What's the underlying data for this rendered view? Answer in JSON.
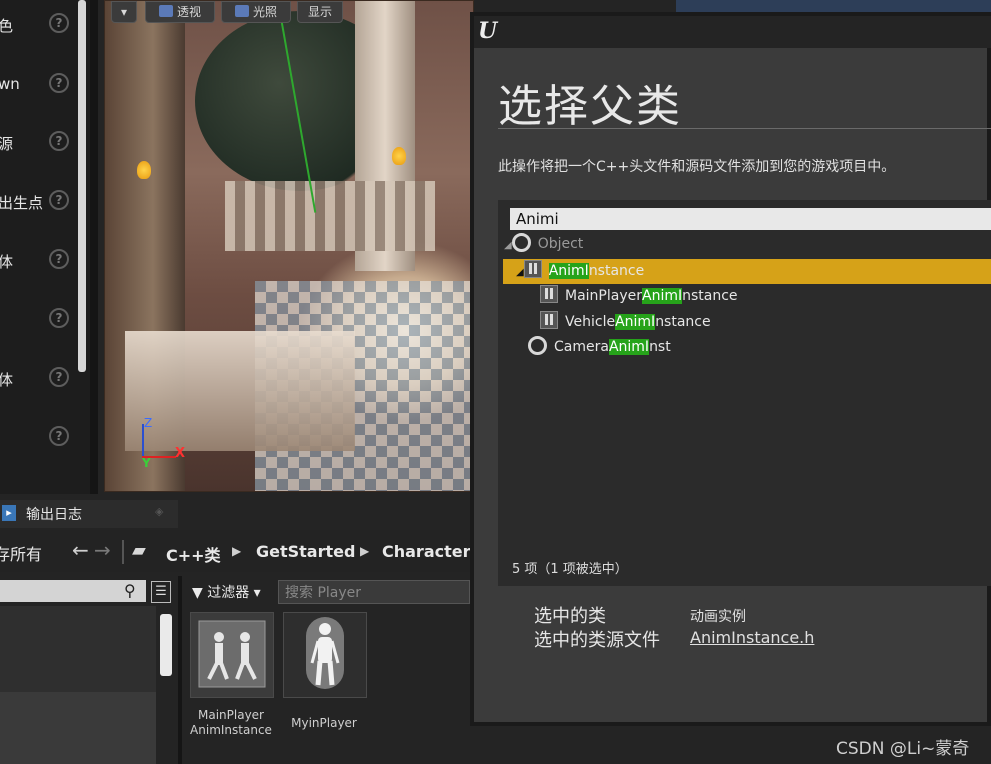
{
  "details_panel": {
    "rows": [
      {
        "label": "色",
        "help": "?"
      },
      {
        "label": "wn",
        "help": "?"
      },
      {
        "label": "源",
        "help": "?"
      },
      {
        "label": "出生点",
        "help": "?"
      },
      {
        "label": "体",
        "help": "?"
      },
      {
        "label": "",
        "help": "?"
      },
      {
        "label": "体",
        "help": "?"
      },
      {
        "label": "",
        "help": "?"
      }
    ]
  },
  "viewport": {
    "buttons": {
      "perspective": "透视",
      "lit": "光照",
      "show": "显示"
    },
    "gizmo": {
      "x": "X",
      "y": "Y",
      "z": "Z"
    }
  },
  "output_log": {
    "title": "输出日志"
  },
  "content_browser": {
    "save_all": "存所有",
    "breadcrumbs": [
      "C++类",
      "GetStarted",
      "Characters"
    ],
    "filter_label": "过滤器",
    "search_placeholder": "搜索 Player",
    "assets": [
      {
        "name_line1": "MainPlayer",
        "name_line2": "AnimInstance"
      },
      {
        "name_line1": "MyinPlayer",
        "name_line2": ""
      }
    ]
  },
  "dialog": {
    "logo": "U",
    "heading": "选择父类",
    "description": "此操作将把一个C++头文件和源码文件添加到您的游戏项目中。",
    "search_value": "Animi",
    "tree": {
      "root": "Object",
      "selected": {
        "prefix": "",
        "match": "AnimI",
        "suffix": "nstance"
      },
      "children": [
        {
          "prefix": "MainPlayer",
          "match": "AnimI",
          "suffix": "nstance"
        },
        {
          "prefix": "Vehicle",
          "match": "AnimI",
          "suffix": "nstance"
        }
      ],
      "sibling": {
        "prefix": "Camera",
        "match": "AnimI",
        "suffix": "nst"
      }
    },
    "item_count": "5 项（1 项被选中）",
    "selected_class_label": "选中的类",
    "selected_class_value": "动画实例",
    "selected_file_label": "选中的类源文件",
    "selected_file_value": "AnimInstance.h"
  },
  "watermark": "CSDN @Li~蒙奇",
  "colors": {
    "selection": "#d6a218",
    "match_highlight": "#26a31a",
    "dialog_bg": "#3b3b3b"
  }
}
